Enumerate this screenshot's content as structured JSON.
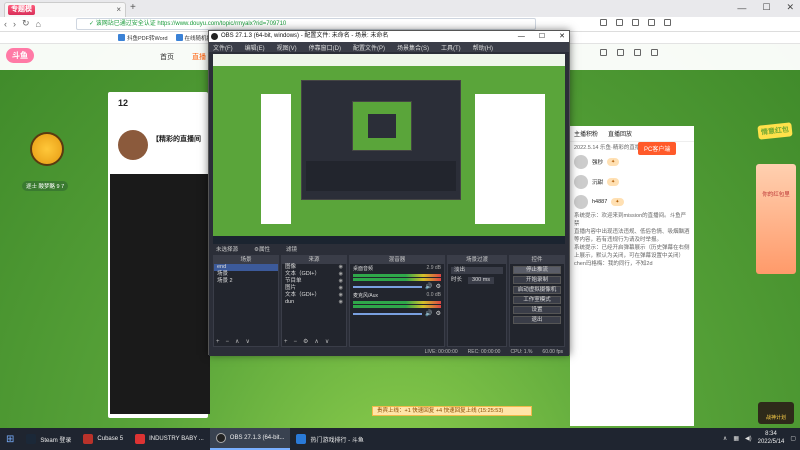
{
  "browser": {
    "tab_badge": "专题模",
    "tab_close": "×",
    "new_tab": "+",
    "win_controls": [
      "—",
      "☐",
      "✕"
    ],
    "nav": [
      "‹",
      "›",
      "↻",
      "⌂"
    ],
    "url_safe": "✓ 该网站已通过安全认证",
    "url_host": "https://www.douyu.com/topic/rmyalx?rid=709710",
    "bookmarks": [
      "抖鱼PDF转Word",
      "在线随机推荐天"
    ]
  },
  "douyu": {
    "logo": "斗鱼",
    "nav_links": [
      "首页",
      "直播"
    ],
    "active_link": "直播",
    "stats": [
      {
        "value": "12",
        "label": ""
      }
    ],
    "anchor_title": "【精彩的直播间",
    "danmu_left": "逐士 酸梦酪 9 7",
    "right_tabs": [
      "主播积粉",
      "直播回放"
    ],
    "pc_button": "PC客户端",
    "chat_intro": "2022.5.14 乐鱼·精彩的直播间",
    "chat_users": [
      {
        "name": "强秒"
      },
      {
        "name": "沉甜"
      },
      {
        "name": "h4887"
      }
    ],
    "chat_lines": [
      "系统提示：欢迎来到mission的直播间。斗鱼严禁",
      "直播内容中出现违法违规、低俗色情、吸烟酗酒",
      "等内容，若有违规行为请及时举报。",
      "系统提示：已经开启弹幕展示（历史弹幕在右侧",
      "上展示，默认为关闭，可在弹幕设置中关闭）"
    ],
    "chat_tail": "chen玛格梅：我的同行，不知2d",
    "gift_logo": "情意红包",
    "redbox_title": "你的红包里",
    "vip_badge": "战神计划",
    "notice": "贵宾上线：+1 快速回复 +4 快速回复上线 (15:25:53)"
  },
  "obs": {
    "title": "OBS 27.1.3 (64-bit, windows) - 配置文件: 未命名 - 场景: 未命名",
    "controls": [
      "—",
      "☐",
      "✕"
    ],
    "menu": [
      "文件(F)",
      "编辑(E)",
      "视图(V)",
      "停靠窗口(D)",
      "配置文件(P)",
      "场景集合(S)",
      "工具(T)",
      "帮助(H)"
    ],
    "status_row": [
      "未选择源",
      "⚙属性",
      "滤镜"
    ],
    "docks": {
      "scenes": {
        "title": "场景",
        "items": [
          "end",
          "场景",
          "场景 2"
        ],
        "selected": 0
      },
      "sources": {
        "title": "来源",
        "items": [
          "图像",
          "文本（GDI+）",
          "节目单",
          "图片",
          "文本（GDI+）",
          "dun"
        ]
      },
      "mixer": {
        "title": "混音器",
        "channels": [
          {
            "label": "桌面音频",
            "db": "2.9 dB"
          },
          {
            "label": "麦克风/Aux",
            "db": "0.0 dB"
          }
        ]
      },
      "transitions": {
        "title": "场景过渡",
        "mode": "淡出",
        "duration_label": "时长",
        "duration": "300 ms"
      },
      "controls": {
        "title": "控件",
        "buttons": [
          "停止推流",
          "开始录制",
          "启动虚拟摄像机",
          "工作室模式",
          "设置",
          "退出"
        ]
      }
    },
    "footer": [
      "LIVE: 00:00:00",
      "REC: 00:00:00",
      "CPU: 1.%",
      "60.00 fps"
    ]
  },
  "taskbar": {
    "items": [
      {
        "label": "Steam 登录",
        "color": "#1b2838"
      },
      {
        "label": "Cubase 5",
        "color": "#b9322a"
      },
      {
        "label": "INDUSTRY BABY ...",
        "color": "#d33"
      },
      {
        "label": "OBS 27.1.3 (64-bit...",
        "color": "#222"
      },
      {
        "label": "热门游戏排行 - 斗鱼",
        "color": "#2a7ad8"
      }
    ],
    "active_index": 3,
    "time": "8:34",
    "date": "2022/5/14"
  }
}
